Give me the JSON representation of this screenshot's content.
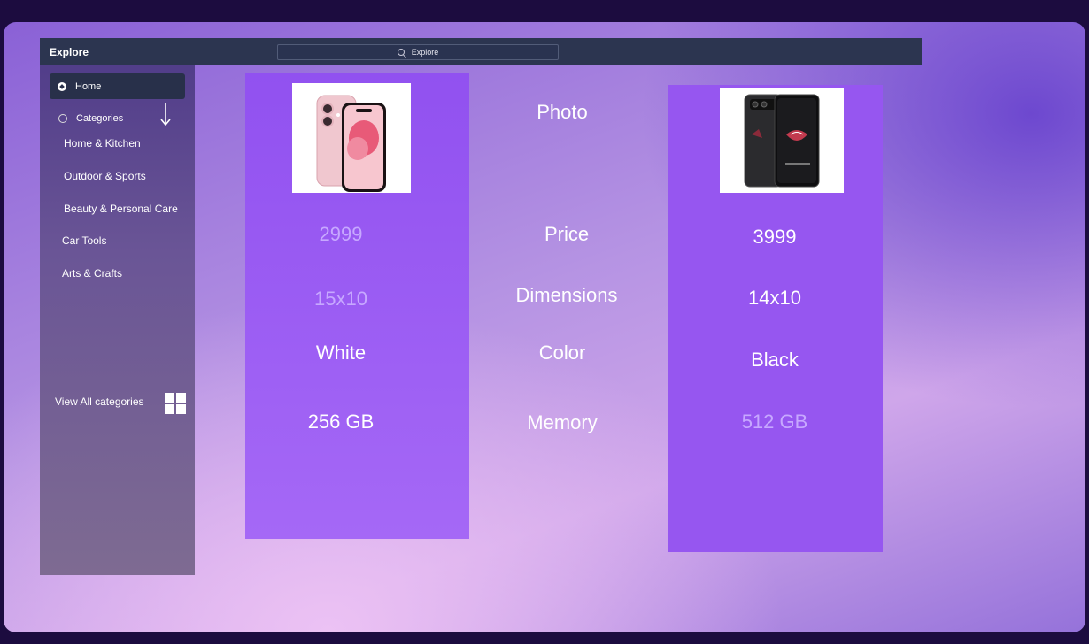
{
  "sidebar": {
    "title": "Explore",
    "home_label": "Home",
    "categories_label": "Categories",
    "categories": [
      "Home & Kitchen",
      "Outdoor & Sports",
      "Beauty & Personal Care",
      "Car Tools",
      "Arts & Crafts"
    ],
    "view_all_label": "View All categories"
  },
  "search": {
    "placeholder": "Explore"
  },
  "compare": {
    "labels": {
      "photo": "Photo",
      "price": "Price",
      "dimensions": "Dimensions",
      "color": "Color",
      "memory": "Memory"
    },
    "left": {
      "price": "2999",
      "dimensions": "15x10",
      "color": "White",
      "memory": "256 GB"
    },
    "right": {
      "price": "3999",
      "dimensions": "14x10",
      "color": "Black",
      "memory": "512 GB"
    }
  },
  "colors": {
    "card": "#9656f0",
    "panel_dark": "#2c3550",
    "muted_text": "#c7a8ff"
  }
}
